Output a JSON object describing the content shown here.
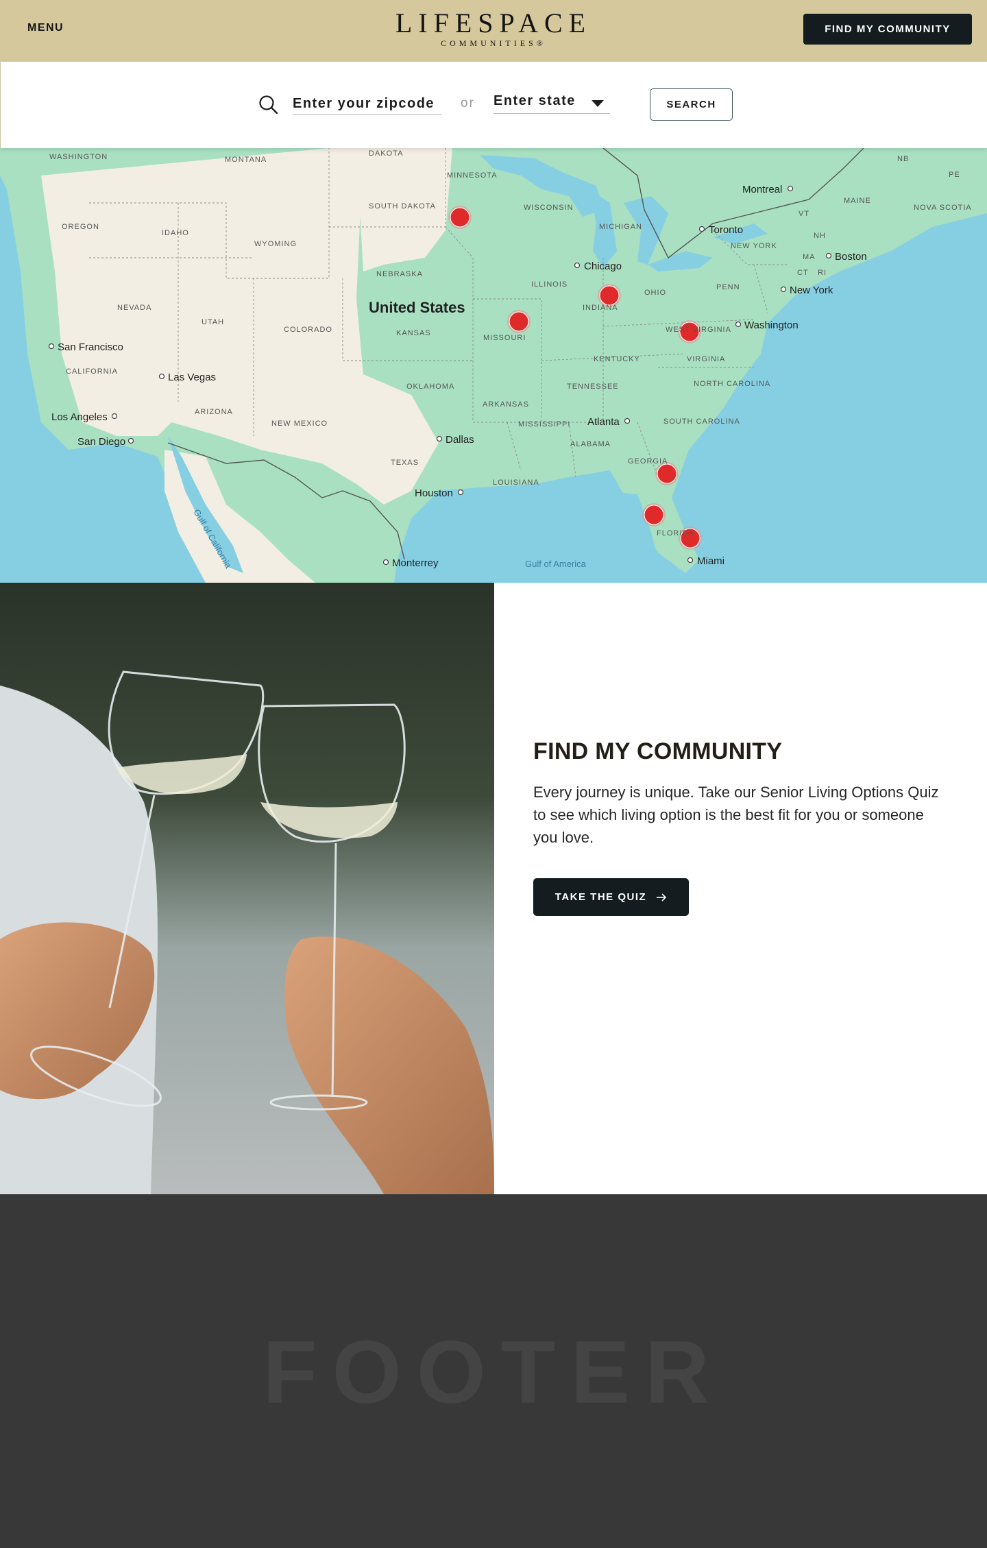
{
  "header": {
    "menu_label": "MENU",
    "logo_main": "LIFESPACE",
    "logo_sub": "COMMUNITIES®",
    "cta_label": "FIND MY COMMUNITY"
  },
  "search": {
    "zip_placeholder": "Enter your zipcode",
    "or_text": "or",
    "state_label": "Enter state",
    "button_label": "SEARCH"
  },
  "map": {
    "country_label": "United States",
    "cities": [
      "Montreal",
      "Toronto",
      "Boston",
      "New York",
      "Washington",
      "Chicago",
      "San Francisco",
      "Las Vegas",
      "Los Angeles",
      "San Diego",
      "Dallas",
      "Houston",
      "Atlanta",
      "Monterrey",
      "Miami"
    ],
    "regions": [
      "WASHINGTON",
      "MONTANA",
      "DAKOTA",
      "MINNESOTA",
      "OREGON",
      "IDAHO",
      "SOUTH DAKOTA",
      "WYOMING",
      "WISCONSIN",
      "MICHIGAN",
      "NEBRASKA",
      "NEVADA",
      "UTAH",
      "COLORADO",
      "KANSAS",
      "MISSOURI",
      "ILLINOIS",
      "INDIANA",
      "OHIO",
      "PENN",
      "CALIFORNIA",
      "ARIZONA",
      "NEW MEXICO",
      "OKLAHOMA",
      "ARKANSAS",
      "TENNESSEE",
      "KENTUCKY",
      "VIRGINIA",
      "WEST VIRGINIA",
      "NORTH CAROLINA",
      "SOUTH CAROLINA",
      "MISSISSIPPI",
      "ALABAMA",
      "GEORGIA",
      "LOUISIANA",
      "TEXAS",
      "FLORIDA",
      "NEW YORK",
      "MAINE",
      "NOVA SCOTIA",
      "VT",
      "NH",
      "MA",
      "CT",
      "RI",
      "NB",
      "PE"
    ],
    "water_labels": [
      "Gulf of California",
      "Gulf of America"
    ],
    "marker_color": "#e02a2a",
    "marker_count": 8
  },
  "feature": {
    "title": "FIND MY COMMUNITY",
    "body": "Every journey is unique. Take our Senior Living Options Quiz to see which living option is the best fit for you or someone you love.",
    "button_label": "TAKE THE QUIZ"
  },
  "footer": {
    "placeholder_text": "FOOTER"
  },
  "colors": {
    "header_bg": "#d5c89c",
    "dark_button": "#141c20",
    "footer_bg": "#383838"
  }
}
